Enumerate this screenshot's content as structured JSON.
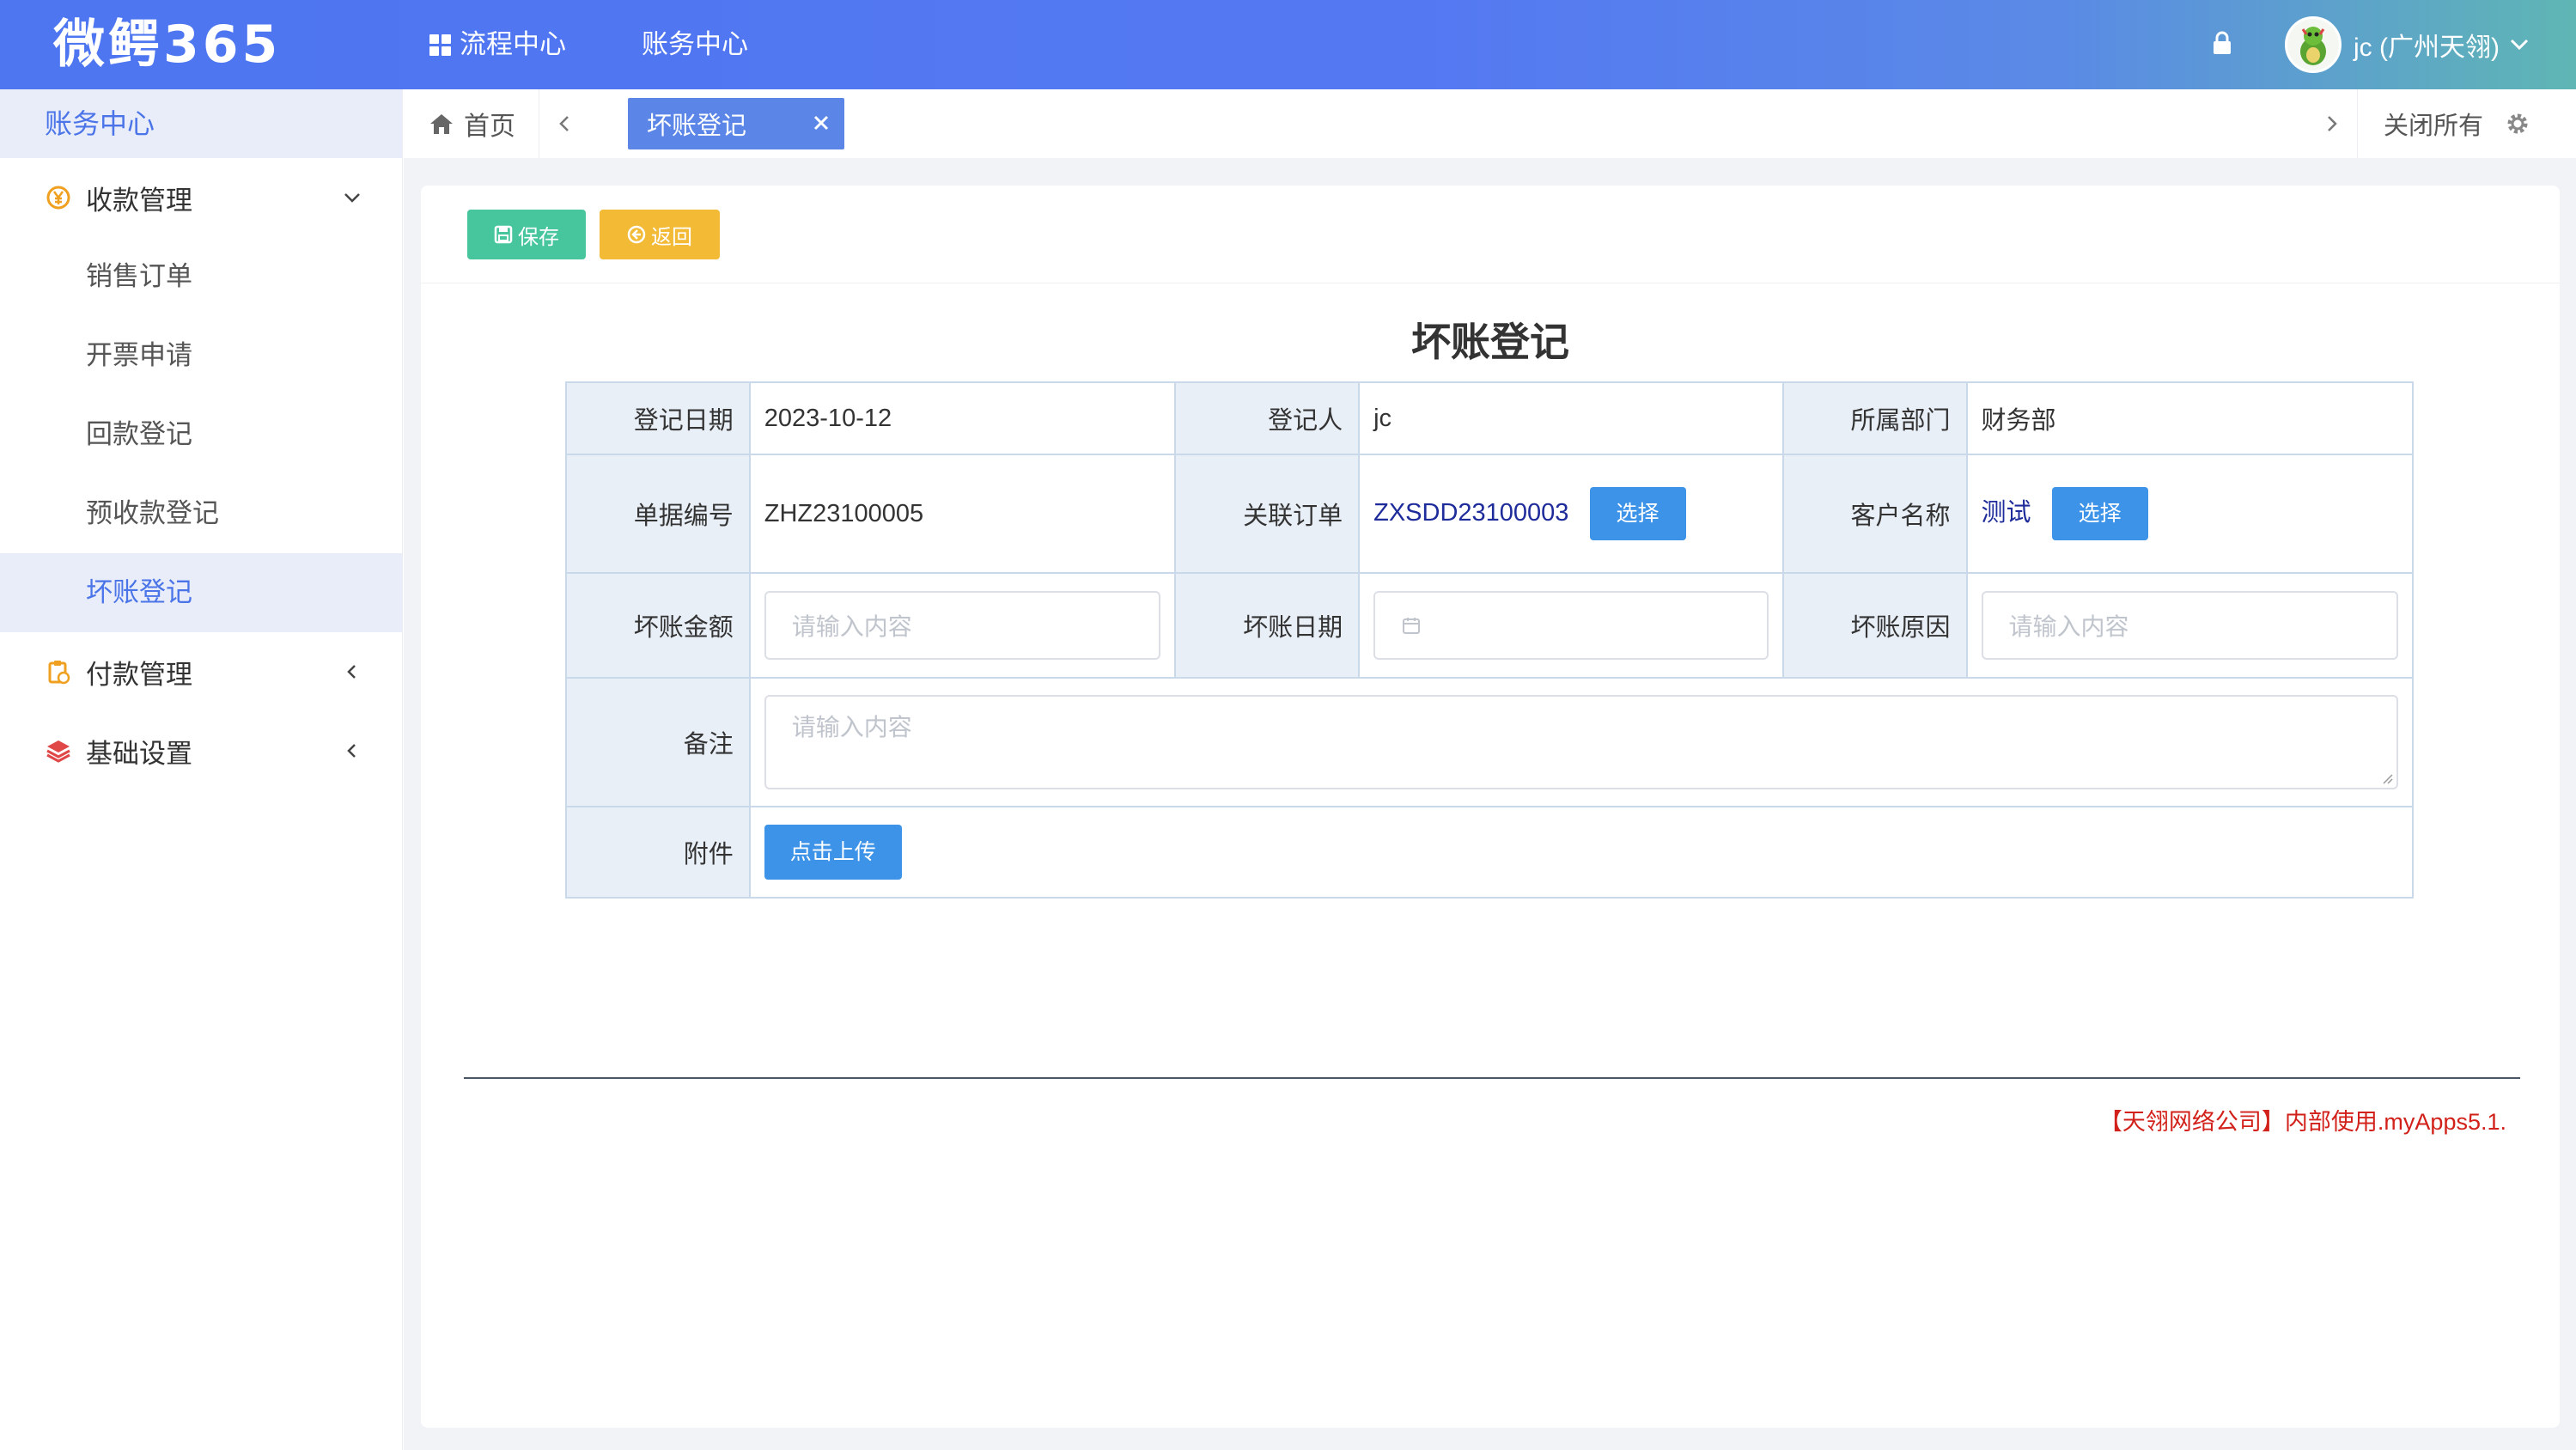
{
  "header": {
    "logo": "微鳄365",
    "nav": [
      {
        "label": "流程中心"
      },
      {
        "label": "账务中心"
      }
    ],
    "user_name": "jc (广州天翎)"
  },
  "sidebar": {
    "title": "账务中心",
    "groups": [
      {
        "label": "收款管理",
        "icon": "yen-circle-icon",
        "expanded": true,
        "items": [
          {
            "label": "销售订单"
          },
          {
            "label": "开票申请"
          },
          {
            "label": "回款登记"
          },
          {
            "label": "预收款登记"
          },
          {
            "label": "坏账登记",
            "active": true
          }
        ]
      },
      {
        "label": "付款管理",
        "icon": "clipboard-icon",
        "expanded": false
      },
      {
        "label": "基础设置",
        "icon": "layers-icon",
        "expanded": false
      }
    ]
  },
  "tabs": {
    "home": "首页",
    "active": "坏账登记",
    "close_all": "关闭所有"
  },
  "toolbar": {
    "save_label": "保存",
    "back_label": "返回"
  },
  "form": {
    "title": "坏账登记",
    "fields": {
      "reg_date_label": "登记日期",
      "reg_date_value": "2023-10-12",
      "registrant_label": "登记人",
      "registrant_value": "jc",
      "dept_label": "所属部门",
      "dept_value": "财务部",
      "doc_no_label": "单据编号",
      "doc_no_value": "ZHZ23100005",
      "order_label": "关联订单",
      "order_value": "ZXSDD23100003",
      "customer_label": "客户名称",
      "customer_value": "测试",
      "choose_label": "选择",
      "amount_label": "坏账金额",
      "amount_placeholder": "请输入内容",
      "bad_date_label": "坏账日期",
      "reason_label": "坏账原因",
      "reason_placeholder": "请输入内容",
      "remark_label": "备注",
      "remark_placeholder": "请输入内容",
      "attachment_label": "附件",
      "upload_label": "点击上传"
    }
  },
  "footer_note": "【天翎网络公司】内部使用.myApps5.1.",
  "colors": {
    "accent": "#4a74e8",
    "save": "#47c59d",
    "back": "#f3ba35",
    "choose": "#3c93e8",
    "note": "#d2201a"
  }
}
